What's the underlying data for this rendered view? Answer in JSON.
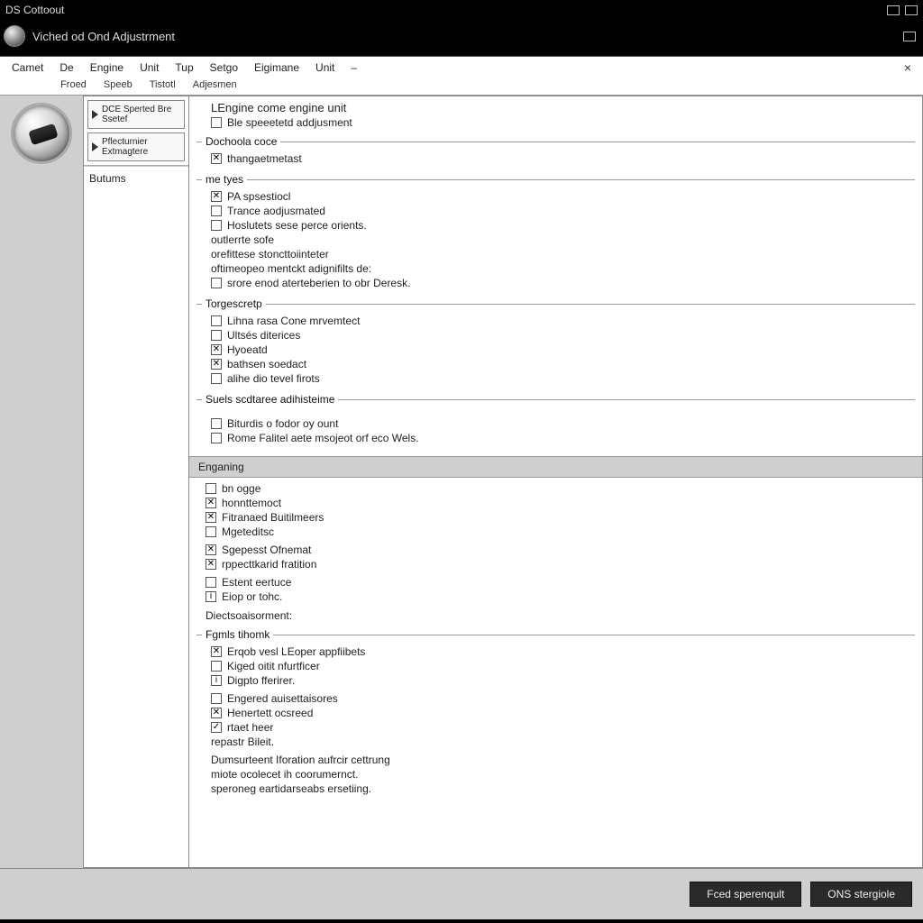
{
  "outer_title": "DS Cottoout",
  "sub_title": "Viched od Ond Adjustrment",
  "menu": [
    "Camet",
    "De",
    "Engine",
    "Unit",
    "Tup",
    "Setgo",
    "Eigimane",
    "Unit",
    "–"
  ],
  "submenu": [
    "Froed",
    "Speeb",
    "Tistotl",
    "Adjesmen"
  ],
  "side": {
    "btn1": "DCE Sperted Bre Ssetef",
    "btn2": "Pflecturnier Extmagtere",
    "heading": "Butums"
  },
  "main": {
    "header": {
      "title": "LEngine come engine unit",
      "c1": {
        "label": "Ble speeetetd addjusment",
        "checked": false
      }
    },
    "g1": {
      "title": "Dochoola coce",
      "items": [
        {
          "label": "thangaetmetast",
          "checked": true
        }
      ]
    },
    "g2": {
      "title": "me tyes",
      "items": [
        {
          "label": "PA spsestiocl",
          "checked": true
        },
        {
          "label": "Trance aodjusmated",
          "checked": false
        },
        {
          "label": "Hoslutets sese perce orients.",
          "checked": false
        }
      ],
      "notes": [
        "outlerrte sofe",
        "orefittese stoncttoiinteter",
        "oftimeopeo mentckt adignifilts de:"
      ],
      "last": {
        "label": "srore enod aterteberien to obr Deresk.",
        "checked": false
      }
    },
    "g3": {
      "title": "Torgescretp",
      "items": [
        {
          "label": "Lihna rasa Cone mrvemtect",
          "checked": false
        },
        {
          "label": "Ultsés diterices",
          "checked": false
        },
        {
          "label": "Hyoeatd",
          "checked": true
        },
        {
          "label": "bathsen soedact",
          "checked": true
        },
        {
          "label": "alihe dio tevel firots",
          "checked": false
        }
      ]
    },
    "g4": {
      "title": "Suels scdtaree adihisteime",
      "items": [
        {
          "label": "Biturdis o fodor oy ount",
          "checked": false
        },
        {
          "label": "Rome Falitel aete msojeot orf eco Wels.",
          "checked": false
        }
      ]
    },
    "banner": "Enganing",
    "g5": {
      "items": [
        {
          "label": "bn ogge",
          "checked": false
        },
        {
          "label": "honnttemoct",
          "checked": true
        },
        {
          "label": "Fitranaed Buitilmeers",
          "checked": true
        },
        {
          "label": "Mgeteditsc",
          "checked": false
        },
        {
          "label": "Sgepesst Ofnemat",
          "checked": true
        },
        {
          "label": "rppecttkarid fratition",
          "checked": true
        },
        {
          "label": "Estent eertuce",
          "checked": false
        },
        {
          "label": "Eiop or tohc.",
          "checked": true
        }
      ]
    },
    "g6": {
      "title": "Diectsoaisorment:",
      "sub": "Fgmls tihomk",
      "items": [
        {
          "label": "Erqob vesl LEoper appfiibets",
          "checked": true
        },
        {
          "label": "Kiged oitit nfurtficer",
          "checked": false
        },
        {
          "label": "Digpto fferirer.",
          "checked": true
        },
        {
          "label": "Engered auisettaisores",
          "checked": false
        },
        {
          "label": "Henertett ocsreed",
          "checked": true
        },
        {
          "label": "rtaet heer",
          "checked": true
        }
      ],
      "tail": [
        "repastr Bileit.",
        "Dumsurteent Iforation aufrcir cettrung",
        "miote ocolecet ih coorumernct.",
        "speroneg eartidarseabs ersetiing."
      ]
    }
  },
  "footer": {
    "b1": "Fced sperenqult",
    "b2": "ONS stergiole"
  }
}
